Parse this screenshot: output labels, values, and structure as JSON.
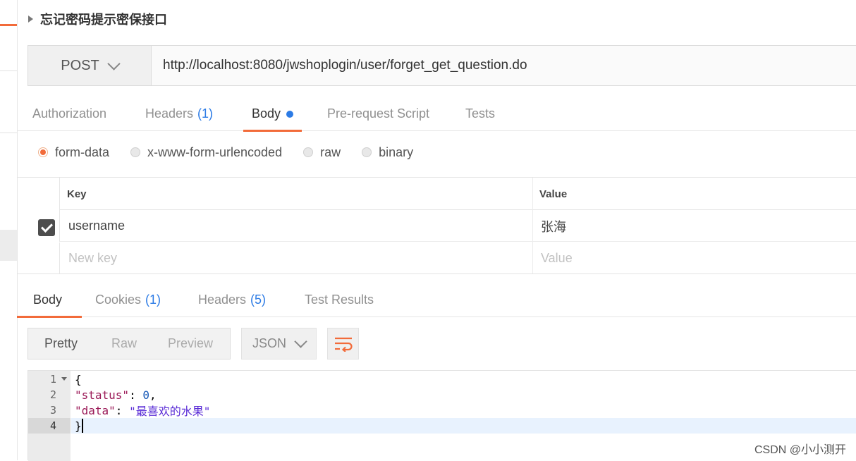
{
  "request": {
    "title": "忘记密码提示密保接口",
    "method": "POST",
    "url": "http://localhost:8080/jwshoplogin/user/forget_get_question.do"
  },
  "request_tabs": [
    {
      "label": "Authorization",
      "count": ""
    },
    {
      "label": "Headers",
      "count": "(1)"
    },
    {
      "label": "Body",
      "count": ""
    },
    {
      "label": "Pre-request Script",
      "count": ""
    },
    {
      "label": "Tests",
      "count": ""
    }
  ],
  "body_types": [
    "form-data",
    "x-www-form-urlencoded",
    "raw",
    "binary"
  ],
  "selected_body_type": "form-data",
  "params": {
    "key_header": "Key",
    "value_header": "Value",
    "rows": [
      {
        "key": "username",
        "value": "张海",
        "checked": true
      }
    ],
    "new_key_placeholder": "New key",
    "new_value_placeholder": "Value"
  },
  "response_tabs": [
    {
      "label": "Body",
      "count": ""
    },
    {
      "label": "Cookies",
      "count": "(1)"
    },
    {
      "label": "Headers",
      "count": "(5)"
    },
    {
      "label": "Test Results",
      "count": ""
    }
  ],
  "view_modes": [
    "Pretty",
    "Raw",
    "Preview"
  ],
  "format": "JSON",
  "code": {
    "line_numbers": [
      "1",
      "2",
      "3",
      "4"
    ],
    "open_brace": "{",
    "close_brace": "}",
    "status_key": "\"status\"",
    "status_value": "0",
    "data_key": "\"data\"",
    "data_value": "\"最喜欢的水果\""
  },
  "watermark": "CSDN @小小测开",
  "colors": {
    "accent": "#f26b3a",
    "link": "#2c7be5"
  }
}
